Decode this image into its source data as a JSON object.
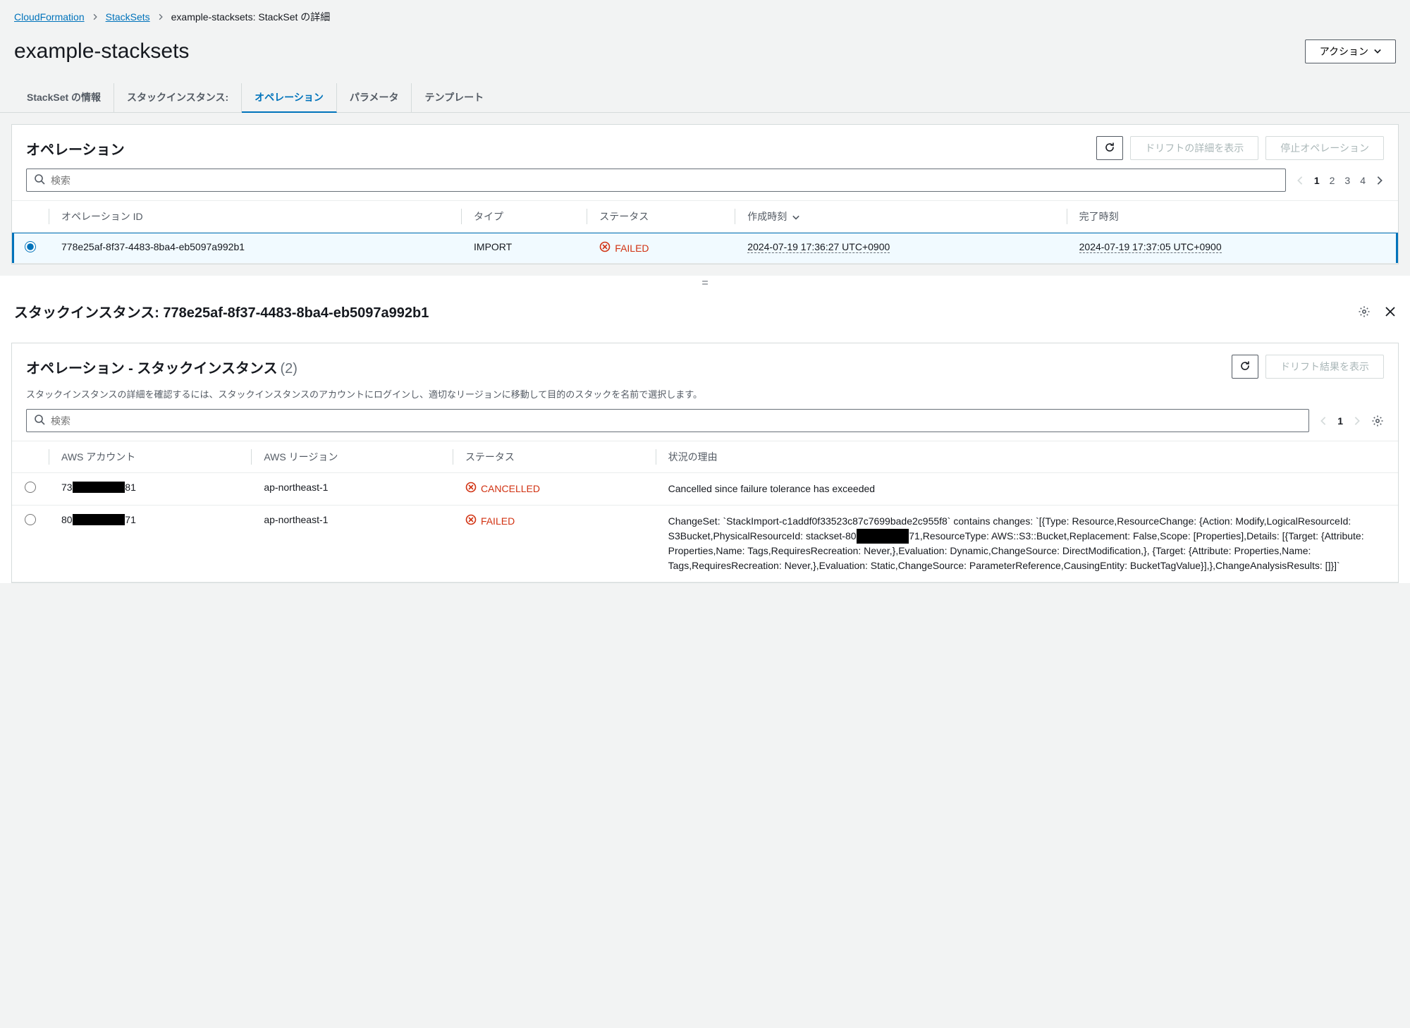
{
  "breadcrumbs": {
    "root": "CloudFormation",
    "mid": "StackSets",
    "current": "example-stacksets: StackSet の詳細"
  },
  "page_title": "example-stacksets",
  "actions_button": "アクション",
  "tabs": {
    "info": "StackSet の情報",
    "instances": "スタックインスタンス:",
    "operations": "オペレーション",
    "parameters": "パラメータ",
    "template": "テンプレート"
  },
  "operations_panel": {
    "title": "オペレーション",
    "drift_button": "ドリフトの詳細を表示",
    "stop_button": "停止オペレーション",
    "search_placeholder": "検索",
    "pagination": {
      "pages": [
        "1",
        "2",
        "3",
        "4"
      ],
      "active": "1"
    },
    "columns": {
      "op_id": "オペレーション ID",
      "type": "タイプ",
      "status": "ステータス",
      "create_time": "作成時刻",
      "end_time": "完了時刻"
    },
    "rows": [
      {
        "selected": true,
        "op_id": "778e25af-8f37-4483-8ba4-eb5097a992b1",
        "type": "IMPORT",
        "status": "FAILED",
        "create_time": "2024-07-19 17:36:27 UTC+0900",
        "end_time": "2024-07-19 17:37:05 UTC+0900"
      }
    ]
  },
  "divider": "=",
  "detail": {
    "title_prefix": "スタックインスタンス: ",
    "title_id": "778e25af-8f37-4483-8ba4-eb5097a992b1"
  },
  "instances_panel": {
    "title": "オペレーション - スタックインスタンス",
    "count": "(2)",
    "subtext": "スタックインスタンスの詳細を確認するには、スタックインスタンスのアカウントにログインし、適切なリージョンに移動して目的のスタックを名前で選択します。",
    "drift_result_button": "ドリフト結果を表示",
    "search_placeholder": "検索",
    "pagination": {
      "active": "1"
    },
    "columns": {
      "account": "AWS アカウント",
      "region": "AWS リージョン",
      "status": "ステータス",
      "reason": "状況の理由"
    },
    "rows": [
      {
        "account_pre": "73",
        "account_post": "81",
        "region": "ap-northeast-1",
        "status": "CANCELLED",
        "reason_parts": [
          "Cancelled since failure tolerance has exceeded"
        ]
      },
      {
        "account_pre": "80",
        "account_post": "71",
        "region": "ap-northeast-1",
        "status": "FAILED",
        "reason_parts": [
          "ChangeSet: `StackImport-c1addf0f33523c87c7699bade2c955f8` contains changes: `[{Type: Resource,ResourceChange: {Action: Modify,LogicalResourceId: S3Bucket,PhysicalResourceId: stackset-80",
          "71,ResourceType: AWS::S3::Bucket,Replacement: False,Scope: [Properties],Details: [{Target: {Attribute: Properties,Name: Tags,RequiresRecreation: Never,},Evaluation: Dynamic,ChangeSource: DirectModification,}, {Target: {Attribute: Properties,Name: Tags,RequiresRecreation: Never,},Evaluation: Static,ChangeSource: ParameterReference,CausingEntity: BucketTagValue}],},ChangeAnalysisResults: []}]`"
        ]
      }
    ]
  }
}
